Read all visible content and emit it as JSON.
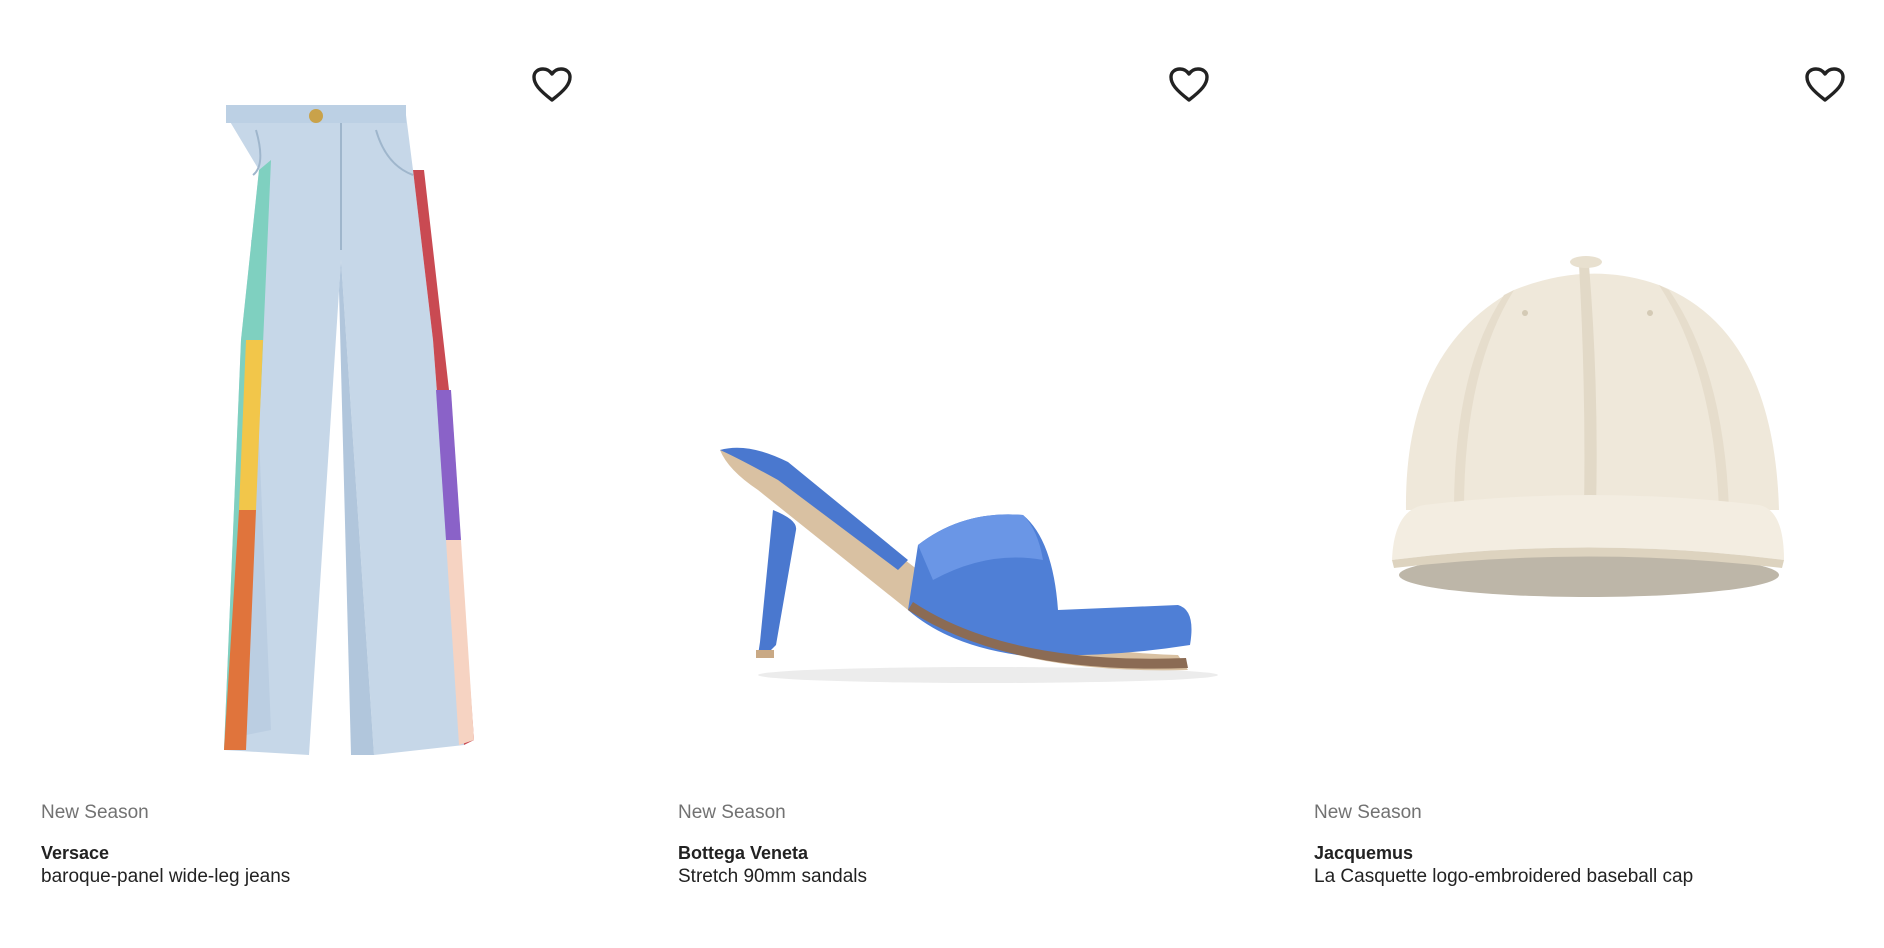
{
  "products": [
    {
      "label": "New Season",
      "brand": "Versace",
      "description": "baroque-panel wide-leg jeans",
      "image_icon": "wide-leg-jeans-image",
      "wishlist_icon": "heart-outline-icon"
    },
    {
      "label": "New Season",
      "brand": "Bottega Veneta",
      "description": "Stretch 90mm sandals",
      "image_icon": "blue-heeled-sandal-image",
      "wishlist_icon": "heart-outline-icon"
    },
    {
      "label": "New Season",
      "brand": "Jacquemus",
      "description": "La Casquette logo-embroidered baseball cap",
      "image_icon": "cream-baseball-cap-image",
      "wishlist_icon": "heart-outline-icon"
    }
  ],
  "colors": {
    "text_primary": "#222222",
    "text_secondary": "#727272",
    "background": "#ffffff"
  }
}
